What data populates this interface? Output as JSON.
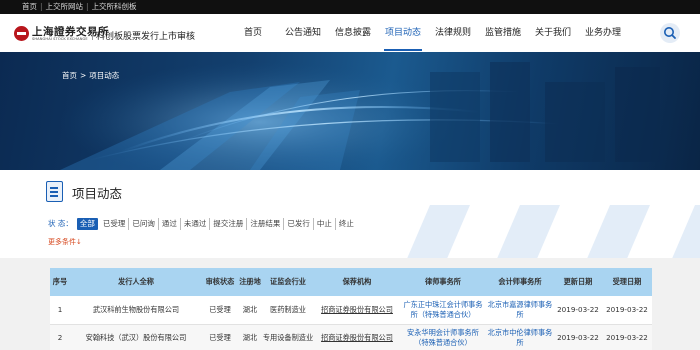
{
  "topbar": {
    "links": [
      "首页",
      "上交所网站",
      "上交所科创板"
    ]
  },
  "header": {
    "logo_cn": "上海證券交易所",
    "logo_en": "SHANGHAI STOCK EXCHANGE",
    "subtitle": "科创板股票发行上市审核",
    "nav": [
      "首页",
      "公告通知",
      "信息披露",
      "项目动态",
      "法律规则",
      "监管措施",
      "关于我们",
      "业务办理"
    ],
    "active_nav": "项目动态"
  },
  "banner": {
    "breadcrumb_home": "首页",
    "breadcrumb_arrow": ">",
    "breadcrumb_current": "项目动态"
  },
  "section": {
    "title": "项目动态"
  },
  "filters": {
    "label": "状 态：",
    "options": [
      "全部",
      "已受理",
      "已问询",
      "通过",
      "未通过",
      "提交注册",
      "注册结果",
      "已发行",
      "中止",
      "终止"
    ],
    "active": "全部",
    "more": "更多条件"
  },
  "table": {
    "headers": [
      "序号",
      "发行人全称",
      "审核状态",
      "注册地",
      "证监会行业",
      "保荐机构",
      "律师事务所",
      "会计师事务所",
      "更新日期",
      "受理日期"
    ],
    "rows": [
      {
        "no": "1",
        "issuer": "武汉科前生物股份有限公司",
        "status": "已受理",
        "region": "湖北",
        "industry": "医药制造业",
        "sponsor": "招商证券股份有限公司",
        "law_firm": "广东正中珠江会计师事务所（特殊普通合伙）",
        "accountant": "北京市嘉源律师事务所",
        "updated": "2019-03-22",
        "accepted": "2019-03-22"
      },
      {
        "no": "2",
        "issuer": "安翰科技（武汉）股份有限公司",
        "status": "已受理",
        "region": "湖北",
        "industry": "专用设备制造业",
        "sponsor": "招商证券股份有限公司",
        "law_firm": "安永华明会计师事务所（特殊普通合伙）",
        "accountant": "北京市中伦律师事务所",
        "updated": "2019-03-22",
        "accepted": "2019-03-22"
      }
    ]
  },
  "colors": {
    "accent": "#1a5fb4",
    "table_header": "#a9d4f1",
    "banner_dark": "#0b2a52",
    "more_link": "#d6451b"
  },
  "icons": {
    "search": "search-icon",
    "section": "document-icon",
    "logo": "sse-logo-icon",
    "more": "arrow-down-icon"
  }
}
